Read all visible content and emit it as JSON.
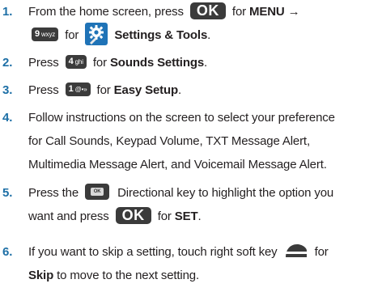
{
  "steps": [
    {
      "number": "1.",
      "line1_pre": "From the home screen, press",
      "line1_post": "for",
      "line1_bold": "MENU",
      "line1_arrow": "→",
      "line2_for": "for",
      "line2_bold": "Settings & Tools",
      "line2_end": "."
    },
    {
      "number": "2.",
      "pre": "Press",
      "post": "for",
      "bold": "Sounds Settings",
      "end": "."
    },
    {
      "number": "3.",
      "pre": "Press",
      "post": "for",
      "bold": "Easy Setup",
      "end": "."
    },
    {
      "number": "4.",
      "line1": "Follow instructions on the screen to select your preference",
      "line2": "for Call Sounds, Keypad Volume, TXT Message Alert,",
      "line3": "Multimedia Message Alert, and Voicemail Message Alert."
    },
    {
      "number": "5.",
      "line1_pre": "Press the",
      "line1_post": "Directional key to highlight the option you",
      "line2_pre": "want and press",
      "line2_post": "for",
      "line2_bold": "SET",
      "line2_end": "."
    },
    {
      "number": "6.",
      "line1_pre": "If you want to skip a setting, touch right soft key",
      "line1_post": "for",
      "line2_bold": "Skip",
      "line2_post": "to move to the next setting."
    }
  ],
  "keys": {
    "ok": "OK",
    "dir_inner": "OK",
    "key9_digit": "9",
    "key9_letters": "wxyz",
    "key4_digit": "4",
    "key4_letters": "ghi",
    "key1_digit": "1",
    "key1_letters": "@•»"
  },
  "colors": {
    "step_number": "#1d6fa6",
    "text": "#231f20",
    "key_background": "#3b3b3b",
    "settings_icon_background": "#1f73b7"
  },
  "icons": {
    "settings_tools": "gear-icon",
    "right_soft_key": "soft-key-icon",
    "directional_key": "directional-key-icon"
  }
}
